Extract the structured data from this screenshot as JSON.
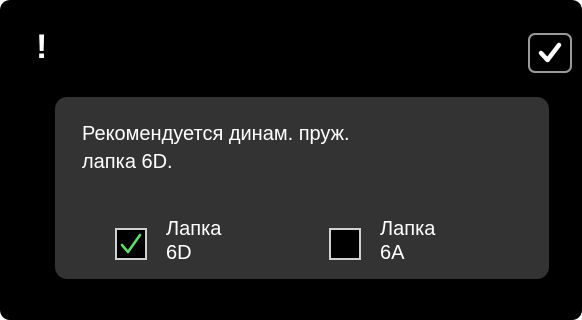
{
  "dialog": {
    "alert_glyph": "!",
    "confirm_icon": "checkmark-icon",
    "message_line1": "Рекомендуется динам. пруж.",
    "message_line2": "лапка 6D.",
    "options": [
      {
        "label_line1": "Лапка",
        "label_line2": "6D",
        "checked": true
      },
      {
        "label_line1": "Лапка",
        "label_line2": "6A",
        "checked": false
      }
    ]
  },
  "colors": {
    "background": "#000000",
    "panel": "#333333",
    "text": "#ffffff",
    "check_accent": "#5de06a",
    "button_border": "#9a9a9a"
  }
}
